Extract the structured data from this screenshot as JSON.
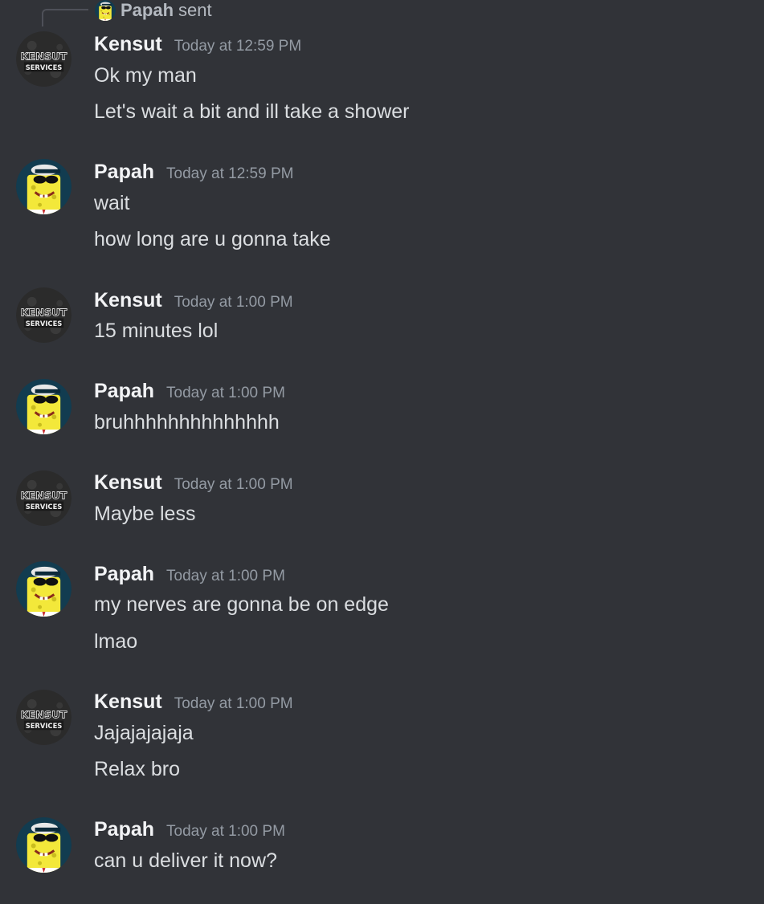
{
  "reply": {
    "author": "Papah",
    "verb": "sent"
  },
  "messages": [
    {
      "author": "Kensut",
      "time": "Today at 12:59 PM",
      "lines": [
        "Ok my man",
        "Let's wait a bit and ill take a shower"
      ]
    },
    {
      "author": "Papah",
      "time": "Today at 12:59 PM",
      "lines": [
        "wait",
        "how long are u gonna take"
      ]
    },
    {
      "author": "Kensut",
      "time": "Today at 1:00 PM",
      "lines": [
        "15 minutes lol"
      ]
    },
    {
      "author": "Papah",
      "time": "Today at 1:00 PM",
      "lines": [
        "bruhhhhhhhhhhhhhh"
      ]
    },
    {
      "author": "Kensut",
      "time": "Today at 1:00 PM",
      "lines": [
        "Maybe less"
      ]
    },
    {
      "author": "Papah",
      "time": "Today at 1:00 PM",
      "lines": [
        "my nerves are gonna be on edge",
        "lmao"
      ]
    },
    {
      "author": "Kensut",
      "time": "Today at 1:00 PM",
      "lines": [
        "Jajajajajaja",
        "Relax bro"
      ]
    },
    {
      "author": "Papah",
      "time": "Today at 1:00 PM",
      "lines": [
        "can u deliver it now?"
      ]
    }
  ],
  "avatars": {
    "kensut": {
      "top_text": "KENSUT",
      "bottom_text": "SERVICES",
      "icon": "kensut-services-logo"
    },
    "papah": {
      "icon": "spongebob-sunglasses-avatar"
    }
  },
  "colors": {
    "background": "#313338",
    "author": "#f2f3f5",
    "timestamp": "#949ba4",
    "message_text": "#dbdee1",
    "reply_text": "#b5bac1"
  }
}
